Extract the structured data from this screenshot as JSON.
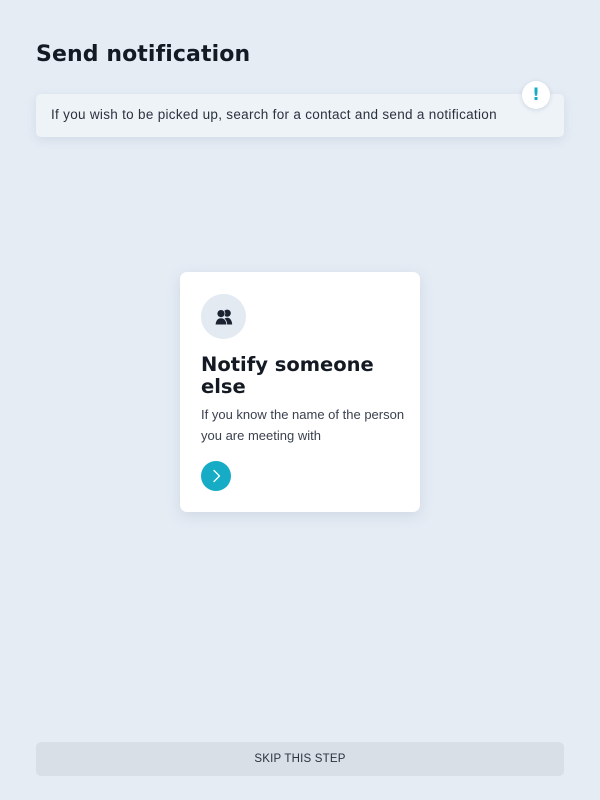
{
  "page": {
    "title": "Send notification"
  },
  "info": {
    "text": "If you wish to be picked up, search for a contact and send a notification",
    "icon": "exclamation-icon",
    "icon_glyph": "!"
  },
  "card": {
    "icon": "people-icon",
    "title": "Notify someone else",
    "description": "If you know the name of the person you are meeting with",
    "action_icon": "chevron-right-icon"
  },
  "footer": {
    "skip_label": "SKIP THIS STEP"
  },
  "colors": {
    "accent": "#16acc6",
    "background": "#e5ecf4",
    "card": "#ffffff",
    "skip_button": "#d9dfe7"
  }
}
